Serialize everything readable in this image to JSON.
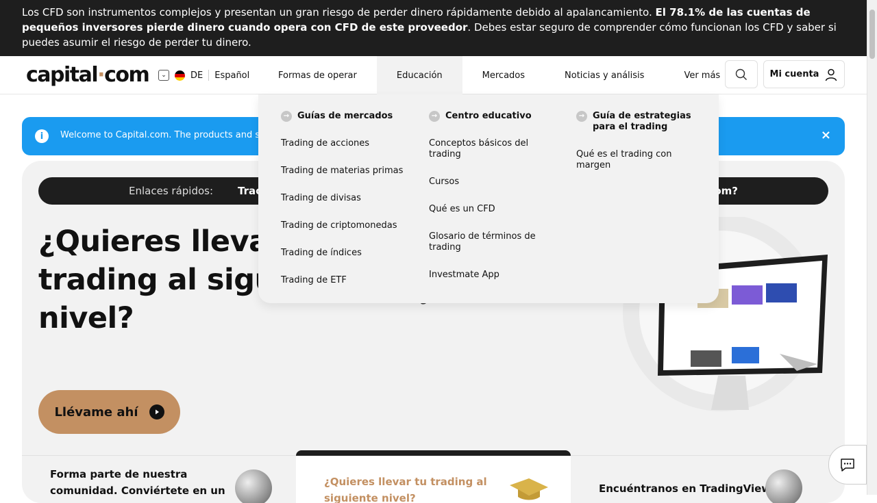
{
  "risk_warning": {
    "part1": "Los CFD son instrumentos complejos y presentan un gran riesgo de perder dinero rápidamente debido al apalancamiento. ",
    "bold": "El 78.1% de las cuentas de pequeños inversores pierde dinero cuando opera con CFD de este proveedor",
    "part2": ". Debes estar seguro de comprender cómo funcionan los CFD y saber si puedes asumir el riesgo de perder tu dinero."
  },
  "header": {
    "logo": "capital",
    "logo_dot": "·",
    "logo_tld": "com",
    "country": "DE",
    "language": "Español",
    "nav": [
      "Formas de operar",
      "Educación",
      "Mercados",
      "Noticias y análisis",
      "Ver más"
    ],
    "account": "Mi cuenta"
  },
  "alert": {
    "text": "Welcome to Capital.com. The products and servi",
    "close": "×",
    "info": "i"
  },
  "quick_links": {
    "label": "Enlaces rápidos:",
    "first": "Trac",
    "last": "om?"
  },
  "hero": {
    "title_lines": [
      "¿Quieres llevar",
      "trading al sigu",
      "nivel?"
    ],
    "sub_fragment": "g",
    "cta": "Llévame ahí"
  },
  "bottom": {
    "card1": "Forma parte de nuestra comunidad. Conviértete en un",
    "card2": "¿Quieres llevar tu trading al siguiente nivel?",
    "card3": "Encuéntranos en TradingView"
  },
  "mega_menu": {
    "columns": [
      {
        "heading": "Guías de mercados",
        "links": [
          "Trading de acciones",
          "Trading de materias primas",
          "Trading de divisas",
          "Trading de criptomonedas",
          "Trading de índices",
          "Trading de ETF"
        ]
      },
      {
        "heading": "Centro educativo",
        "links": [
          "Conceptos básicos del trading",
          "Cursos",
          "Qué es un CFD",
          "Glosario de términos de trading",
          "Investmate App"
        ]
      },
      {
        "heading": "Guía de estrategias para el trading",
        "links": [
          "Qué es el trading con margen"
        ]
      }
    ]
  },
  "colors": {
    "accent": "#c39062",
    "dark": "#1e1e1e",
    "alert_blue": "#1a9bf0"
  }
}
